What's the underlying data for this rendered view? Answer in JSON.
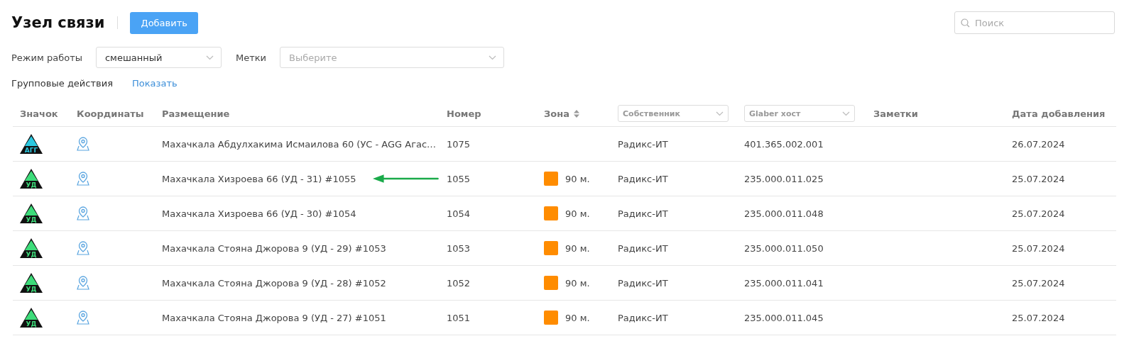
{
  "title": "Узел связи",
  "add_button": "Добавить",
  "search": {
    "placeholder": "Поиск"
  },
  "filters": [
    {
      "label": "Режим работы",
      "value": "смешанный"
    },
    {
      "label": "Метки",
      "placeholder": "Выберите"
    }
  ],
  "group_actions": {
    "label": "Групповые действия",
    "link": "Показать"
  },
  "table": {
    "columns": [
      {
        "kind": "text",
        "label": "Значок"
      },
      {
        "kind": "text",
        "label": "Координаты"
      },
      {
        "kind": "text",
        "label": "Размещение"
      },
      {
        "kind": "text",
        "label": "Номер"
      },
      {
        "kind": "sort",
        "label": "Зона"
      },
      {
        "kind": "select",
        "label": "Собственник"
      },
      {
        "kind": "select",
        "label": "Glaber хост"
      },
      {
        "kind": "text",
        "label": "Заметки"
      },
      {
        "kind": "text",
        "label": "Дата добавления"
      }
    ],
    "rows": [
      {
        "badge": {
          "label": "АГГ",
          "color": "#2bc8e0"
        },
        "place": "Махачкала Абдулхакима Исмаилова 60 (УС - AGG Агас…",
        "arrow": false,
        "number": "1075",
        "zone": null,
        "owner": "Радикс-ИТ",
        "host": "401.365.002.001",
        "date": "26.07.2024"
      },
      {
        "badge": {
          "label": "УД",
          "color": "#3ddc7a"
        },
        "place": "Махачкала Хизроева 66 (УД - 31) #1055",
        "arrow": true,
        "number": "1055",
        "zone": {
          "color": "#ff8c00",
          "text": "90 м."
        },
        "owner": "Радикс-ИТ",
        "host": "235.000.011.025",
        "date": "25.07.2024"
      },
      {
        "badge": {
          "label": "УД",
          "color": "#3ddc7a"
        },
        "place": "Махачкала Хизроева 66 (УД - 30) #1054",
        "arrow": false,
        "number": "1054",
        "zone": {
          "color": "#ff8c00",
          "text": "90 м."
        },
        "owner": "Радикс-ИТ",
        "host": "235.000.011.048",
        "date": "25.07.2024"
      },
      {
        "badge": {
          "label": "УД",
          "color": "#3ddc7a"
        },
        "place": "Махачкала Стояна Джорова 9 (УД - 29) #1053",
        "arrow": false,
        "number": "1053",
        "zone": {
          "color": "#ff8c00",
          "text": "90 м."
        },
        "owner": "Радикс-ИТ",
        "host": "235.000.011.050",
        "date": "25.07.2024"
      },
      {
        "badge": {
          "label": "УД",
          "color": "#3ddc7a"
        },
        "place": "Махачкала Стояна Джорова 9 (УД - 28) #1052",
        "arrow": false,
        "number": "1052",
        "zone": {
          "color": "#ff8c00",
          "text": "90 м."
        },
        "owner": "Радикс-ИТ",
        "host": "235.000.011.041",
        "date": "25.07.2024"
      },
      {
        "badge": {
          "label": "УД",
          "color": "#3ddc7a"
        },
        "place": "Махачкала Стояна Джорова 9 (УД - 27) #1051",
        "arrow": false,
        "number": "1051",
        "zone": {
          "color": "#ff8c00",
          "text": "90 м."
        },
        "owner": "Радикс-ИТ",
        "host": "235.000.011.045",
        "date": "25.07.2024"
      }
    ]
  }
}
